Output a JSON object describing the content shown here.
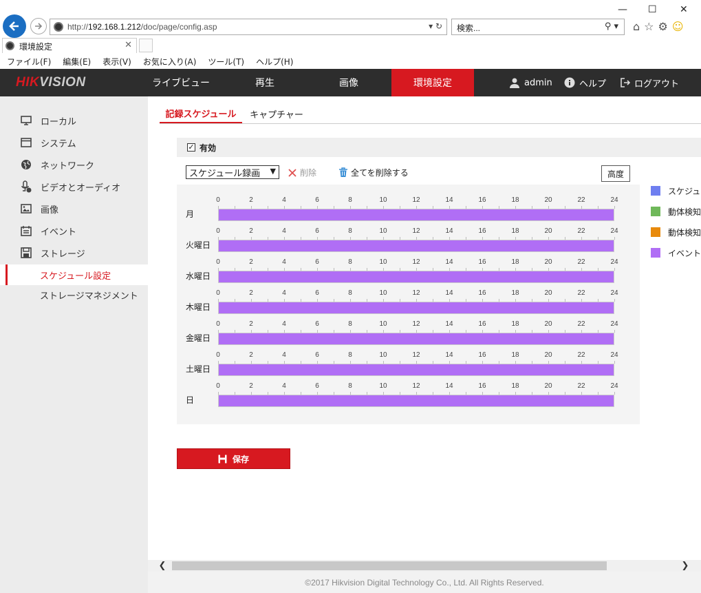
{
  "browser": {
    "url_prefix": "http://",
    "url_host": "192.168.1.212",
    "url_path": "/doc/page/config.asp",
    "search_placeholder": "検索...",
    "tab_title": "環境設定",
    "menu": [
      "ファイル(F)",
      "編集(E)",
      "表示(V)",
      "お気に入り(A)",
      "ツール(T)",
      "ヘルプ(H)"
    ]
  },
  "header": {
    "logo_red": "HIK",
    "logo_grey": "VISION",
    "nav": [
      "ライブビュー",
      "再生",
      "画像",
      "環境設定"
    ],
    "active_nav": 3,
    "user": "admin",
    "help": "ヘルプ",
    "logout": "ログアウト"
  },
  "sidebar": {
    "items": [
      {
        "label": "ローカル",
        "icon": "monitor-icon"
      },
      {
        "label": "システム",
        "icon": "window-icon"
      },
      {
        "label": "ネットワーク",
        "icon": "globe-icon"
      },
      {
        "label": "ビデオとオーディオ",
        "icon": "microphone-icon"
      },
      {
        "label": "画像",
        "icon": "image-icon"
      },
      {
        "label": "イベント",
        "icon": "calendar-icon"
      },
      {
        "label": "ストレージ",
        "icon": "storage-icon"
      }
    ],
    "sub_items": [
      "スケジュール設定",
      "ストレージマネジメント"
    ],
    "active_sub": 0
  },
  "main": {
    "tabs": [
      "記録スケジュール",
      "キャプチャー"
    ],
    "active_tab": 0,
    "enable_label": "有効",
    "enable_checked": true,
    "schedule_type": "スケジュール録画",
    "delete_label": "削除",
    "delete_all_label": "全てを削除する",
    "advanced_label": "高度",
    "save_label": "保存",
    "tick_labels": [
      "0",
      "2",
      "4",
      "6",
      "8",
      "10",
      "12",
      "14",
      "16",
      "18",
      "20",
      "22",
      "24"
    ],
    "days": [
      {
        "label": "月",
        "start": 0,
        "end": 24,
        "type": "event"
      },
      {
        "label": "火曜日",
        "start": 0,
        "end": 24,
        "type": "event"
      },
      {
        "label": "水曜日",
        "start": 0,
        "end": 24,
        "type": "event"
      },
      {
        "label": "木曜日",
        "start": 0,
        "end": 24,
        "type": "event"
      },
      {
        "label": "金曜日",
        "start": 0,
        "end": 24,
        "type": "event"
      },
      {
        "label": "土曜日",
        "start": 0,
        "end": 24,
        "type": "event"
      },
      {
        "label": "日",
        "start": 0,
        "end": 24,
        "type": "event"
      }
    ],
    "legend": [
      {
        "key": "schedule",
        "label": "スケジュ",
        "color": "#6f7ff0"
      },
      {
        "key": "motion",
        "label": "動体検知",
        "color": "#6fb85a"
      },
      {
        "key": "motion_alarm",
        "label": "動体検知",
        "color": "#e88a0c"
      },
      {
        "key": "event",
        "label": "イベント",
        "color": "#b06ef5"
      }
    ]
  },
  "footer": {
    "copyright": "©2017 Hikvision Digital Technology Co., Ltd. All Rights Reserved."
  }
}
